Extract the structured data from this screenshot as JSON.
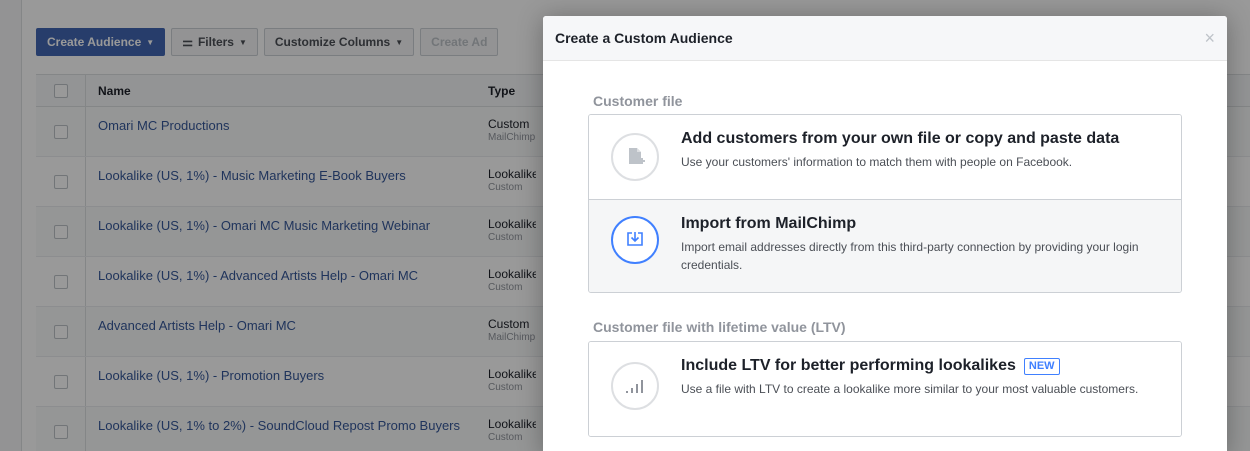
{
  "toolbar": {
    "create_audience": "Create Audience",
    "filters": "Filters",
    "customize_columns": "Customize Columns",
    "create_ad": "Create Ad"
  },
  "table": {
    "headers": {
      "name": "Name",
      "type": "Type"
    },
    "rows": [
      {
        "name": "Omari MC Productions",
        "type": "Custom",
        "sub": "MailChimp"
      },
      {
        "name": "Lookalike (US, 1%) - Music Marketing E-Book Buyers",
        "type": "Lookalike",
        "sub": "Custom"
      },
      {
        "name": "Lookalike (US, 1%) - Omari MC Music Marketing Webinar",
        "type": "Lookalike",
        "sub": "Custom"
      },
      {
        "name": "Lookalike (US, 1%) - Advanced Artists Help - Omari MC",
        "type": "Lookalike",
        "sub": "Custom"
      },
      {
        "name": "Advanced Artists Help - Omari MC",
        "type": "Custom",
        "sub": "MailChimp"
      },
      {
        "name": "Lookalike (US, 1%) - Promotion Buyers",
        "type": "Lookalike",
        "sub": "Custom"
      },
      {
        "name": "Lookalike (US, 1% to 2%) - SoundCloud Repost Promo Buyers",
        "type": "Lookalike",
        "sub": "Custom"
      }
    ]
  },
  "modal": {
    "title": "Create a Custom Audience",
    "close": "×",
    "section1_title": "Customer file",
    "section2_title": "Customer file with lifetime value (LTV)",
    "options": [
      {
        "title": "Add customers from your own file or copy and paste data",
        "desc": "Use your customers' information to match them with people on Facebook."
      },
      {
        "title": "Import from MailChimp",
        "desc": "Import email addresses directly from this third-party connection by providing your login credentials."
      },
      {
        "title": "Include LTV for better performing lookalikes",
        "badge": "NEW",
        "desc": "Use a file with LTV to create a lookalike more similar to your most valuable customers."
      }
    ]
  },
  "colors": {
    "primary": "#4267b2",
    "accent": "#4080ff",
    "link": "#365899"
  }
}
